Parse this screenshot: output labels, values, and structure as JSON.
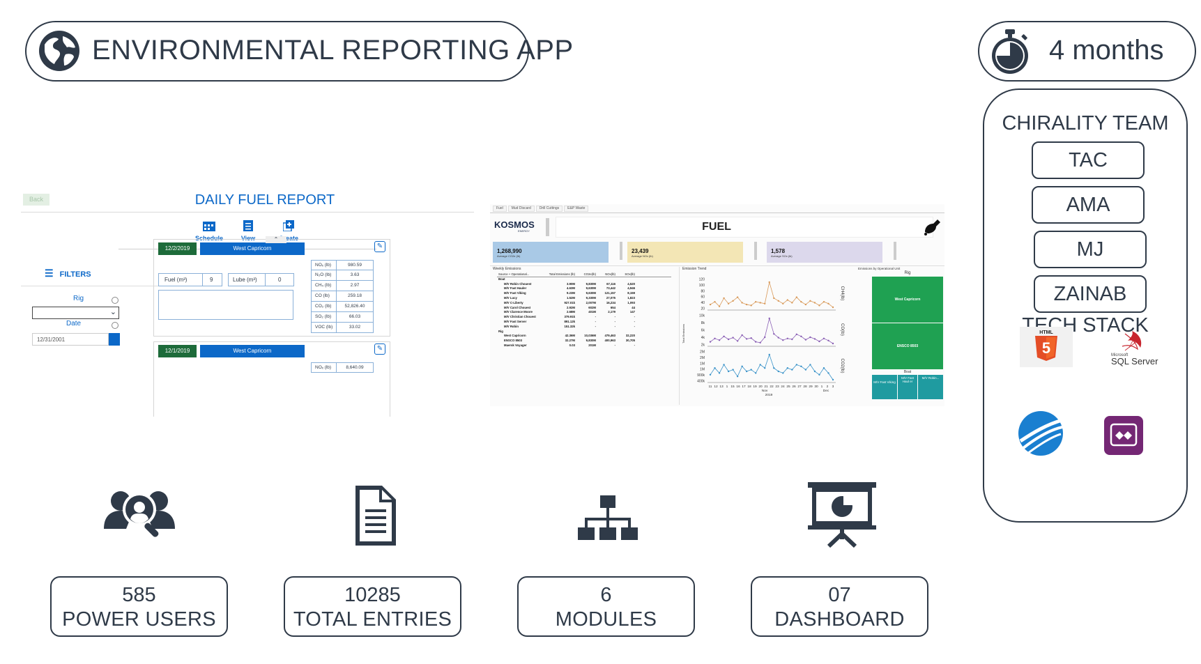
{
  "header": {
    "title": "ENVIRONMENTAL REPORTING APP",
    "duration": "4 months"
  },
  "team": {
    "heading": "CHIRALITY TEAM",
    "members": [
      "TAC",
      "AMA",
      "MJ",
      "ZAINAB"
    ],
    "tech_heading": "TECH STACK",
    "tech": [
      {
        "icon": "html5-logo",
        "label": "HTML",
        "badge": "5"
      },
      {
        "icon": "sql-server-logo",
        "label": "SQL Server",
        "sublabel": "Microsoft"
      },
      {
        "icon": "tableau-swoosh-logo"
      },
      {
        "icon": "power-apps-logo"
      }
    ]
  },
  "fuel_report": {
    "back": "Back",
    "title": "DAILY FUEL REPORT",
    "nav": [
      "Schedule",
      "View",
      "Create"
    ],
    "filters_label": "FILTERS",
    "rig_label": "Rig",
    "date_label": "Date",
    "date_value": "12/31/2001",
    "entries": [
      {
        "date": "12/2/2019",
        "rig": "West Capricorn",
        "fuel_label": "Fuel (m³)",
        "fuel_value": "9",
        "lube_label": "Lube (m³)",
        "lube_value": "0",
        "emissions": [
          [
            "NOₓ (lb)",
            "980.59"
          ],
          [
            "N₂O (lb)",
            "3.63"
          ],
          [
            "CH₄ (lb)",
            "2.97"
          ],
          [
            "CO (lb)",
            "259.18"
          ],
          [
            "CO₂ (lb)",
            "52,826.40"
          ],
          [
            "SO₂ (lb)",
            "66.03"
          ],
          [
            "VOC (lb)",
            "33.02"
          ]
        ]
      },
      {
        "date": "12/1/2019",
        "rig": "West Capricorn",
        "emissions": [
          [
            "NOₓ (lb)",
            "8,640.09"
          ]
        ]
      }
    ]
  },
  "dashboard": {
    "tabs": [
      "Fuel",
      "Mud Discard",
      "Drill Cuttings",
      "E&P Waste"
    ],
    "brand": "KOSMOS",
    "brand_sub": "ENERGY",
    "title": "FUEL",
    "kpis": [
      {
        "value": "1,268,990",
        "label": "Average CO2e (lb)",
        "color": "#a9c9e6"
      },
      {
        "value": "23,439",
        "label": "Average NOx (lb)",
        "color": "#f3e6b5"
      },
      {
        "value": "1,578",
        "label": "Average SOx (lb)",
        "color": "#dcd8ec"
      }
    ],
    "table_title": "Weekly Emissions",
    "table_headers": [
      "Source + Operational...",
      "Total Emissions (lb)",
      "CO2e(lb)",
      "NOx(lb)",
      "SOx(lb)"
    ],
    "table_rows": [
      [
        "Boat",
        "",
        "",
        "",
        ""
      ],
      [
        "M/V Robin Chouest",
        "3.90M",
        "9,830M",
        "67,116",
        "4,520"
      ],
      [
        "M/V Fast Hauler",
        "4.63M",
        "9,630M",
        "73,442",
        "4,946"
      ],
      [
        "M/V Fast Viking",
        "9.23M",
        "9,630M",
        "121,157",
        "8,159"
      ],
      [
        "M/V Lucy",
        "1.52M",
        "9,330M",
        "27,075",
        "1,823"
      ],
      [
        "M/V C-Liberty",
        "927.01k",
        "2,007M",
        "16,234",
        "1,093"
      ],
      [
        "M/V Carol Chouest",
        "2.92M",
        "602M",
        "654",
        "44"
      ],
      [
        "M/V Clarence Moore",
        "2.68M",
        "401M",
        "2,179",
        "147"
      ],
      [
        "M/V Christian Chouest",
        "379.91k",
        "-",
        "-",
        "-"
      ],
      [
        "M/V Fast Server",
        "891.12k",
        "-",
        "-",
        "-"
      ],
      [
        "M/V Robin",
        "151.32k",
        "-",
        "-",
        "-"
      ],
      [
        "Rig",
        "",
        "",
        "",
        ""
      ],
      [
        "West Capricorn",
        "42.36M",
        "10,036M",
        "479,463",
        "32,220"
      ],
      [
        "ENSCO 8503",
        "32.27M",
        "9,830M",
        "400,963",
        "30,705"
      ],
      [
        "Maersk Voyager",
        "0.03",
        "201M",
        "-",
        "-"
      ]
    ],
    "trend_title": "Emission Trend",
    "trend_y_label": "Total Emissions",
    "trend_panels": [
      {
        "label": "CH4(lb)",
        "ticks": [
          "120",
          "100",
          "80",
          "60",
          "40",
          "20"
        ],
        "color": "#d99a5a",
        "values": [
          56,
          62,
          52,
          70,
          58,
          64,
          72,
          60,
          56,
          54,
          62,
          60,
          58,
          105,
          70,
          64,
          58,
          66,
          60,
          72,
          62,
          56,
          64,
          60,
          54,
          62,
          58,
          50
        ]
      },
      {
        "label": "CO(lb)",
        "ticks": [
          "10k",
          "8k",
          "6k",
          "4k",
          "2k"
        ],
        "color": "#8a5fb5",
        "values": [
          4.2,
          5.0,
          4.6,
          5.5,
          4.8,
          5.2,
          4.4,
          5.8,
          4.9,
          5.1,
          4.2,
          4.0,
          5.3,
          9.8,
          6.1,
          5.2,
          4.6,
          5.0,
          4.8,
          6.0,
          5.5,
          4.7,
          5.3,
          4.9,
          4.3,
          5.0,
          4.5,
          3.8
        ]
      },
      {
        "label": "CO2(lb)",
        "ticks": [
          "2M",
          "2M",
          "1M",
          "1M",
          "900k",
          "400k"
        ],
        "color": "#3a93c9",
        "values": [
          0.7,
          1.1,
          0.8,
          1.3,
          0.9,
          1.0,
          0.6,
          1.2,
          0.9,
          1.0,
          0.8,
          1.3,
          1.1,
          1.9,
          1.1,
          0.9,
          0.8,
          1.1,
          1.0,
          1.3,
          1.2,
          1.0,
          1.3,
          0.9,
          0.7,
          1.1,
          0.8,
          0.4
        ]
      }
    ],
    "trend_x": [
      "11",
      "12",
      "13",
      "1",
      "15",
      "16",
      "17",
      "18",
      "19",
      "20",
      "21",
      "22",
      "23",
      "24",
      "25",
      "26",
      "27",
      "28",
      "29",
      "30",
      "1",
      "2",
      "3"
    ],
    "trend_x_groups": [
      "Nov",
      "Dec"
    ],
    "trend_x_year": "2019",
    "unit_title": "Emissions by Operational Unit",
    "unit_rig_label": "Rig",
    "unit_blocks": [
      "West Capricorn",
      "ENSCO 8503"
    ],
    "unit_boat_label": "Boat",
    "unit_boats": [
      "M/V Fast Viking",
      "M/V Fast Haul er",
      "M/V Robin..."
    ]
  },
  "stats": [
    {
      "icon": "users-search-icon",
      "number": "585",
      "label": "POWER USERS"
    },
    {
      "icon": "document-icon",
      "number": "10285",
      "label": "TOTAL ENTRIES"
    },
    {
      "icon": "sitemap-icon",
      "number": "6",
      "label": "MODULES"
    },
    {
      "icon": "presentation-chart-icon",
      "number": "07",
      "label": "DASHBOARD"
    }
  ],
  "colors": {
    "primary": "#2f3a48",
    "app_blue": "#0c68c8",
    "app_green": "#1d6b3a",
    "dash_green": "#1fa152",
    "dash_teal": "#1f9ba0"
  }
}
